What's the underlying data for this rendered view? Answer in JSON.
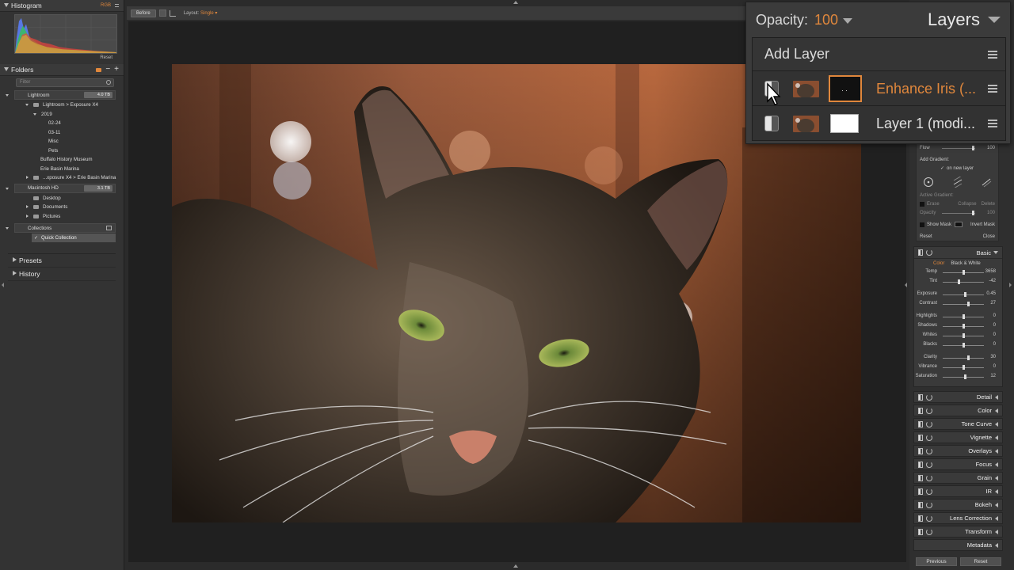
{
  "left_panel": {
    "histogram": {
      "title": "Histogram",
      "channel": "RGB",
      "reset": "Reset"
    },
    "folders": {
      "title": "Folders",
      "filter_placeholder": "Filter",
      "tree": [
        {
          "label": "Lightroom",
          "size": "4.0 TB",
          "kind": "drive"
        },
        {
          "label": "Lightroom > Exposure X4",
          "kind": "folder"
        },
        {
          "label": "2019",
          "kind": "folder"
        },
        {
          "label": "02-24",
          "kind": "leaf"
        },
        {
          "label": "03-11",
          "kind": "leaf"
        },
        {
          "label": "Misc",
          "kind": "leaf"
        },
        {
          "label": "Pets",
          "kind": "leaf"
        },
        {
          "label": "Buffalo History Museum",
          "kind": "leaf"
        },
        {
          "label": "Erie Basin Marina",
          "kind": "leaf"
        },
        {
          "label": "...xposure X4 > Erie Basin Marina",
          "kind": "folder"
        },
        {
          "label": "Macintosh HD",
          "size": "3.1 TB",
          "kind": "drive"
        },
        {
          "label": "Desktop",
          "kind": "folder"
        },
        {
          "label": "Documents",
          "kind": "folder"
        },
        {
          "label": "Pictures",
          "kind": "folder"
        }
      ],
      "collections": "Collections",
      "quick_collection": "Quick Collection"
    },
    "presets": "Presets",
    "history": "History"
  },
  "toolbar": {
    "before_label": "Before",
    "layout_label": "Layout:",
    "layout_value": "Single"
  },
  "layers_panel": {
    "opacity_label": "Opacity:",
    "opacity_value": "100",
    "title": "Layers",
    "add_layer": "Add Layer",
    "layers": [
      {
        "name": "Enhance Iris (...",
        "active": true
      },
      {
        "name": "Layer 1 (modi...",
        "active": false
      }
    ]
  },
  "brush_panel": {
    "flow_label": "Flow",
    "flow_value": "100",
    "add_gradient": "Add Gradient:",
    "on_new_layer": "on new layer",
    "active_gradient": "Active Gradient:",
    "erase": "Erase",
    "collapse": "Collapse",
    "delete": "Delete",
    "opacity_label": "Opacity",
    "opacity_value": "100",
    "show_mask": "Show Mask",
    "invert_mask": "Invert Mask",
    "reset": "Reset",
    "close": "Close"
  },
  "basic_panel": {
    "title": "Basic",
    "color_tab": "Color",
    "bw_tab": "Black & White",
    "adjustments": [
      {
        "label": "Temp",
        "value": "3658",
        "level": 0.5
      },
      {
        "label": "Tint",
        "value": "-42",
        "level": 0.4
      },
      {
        "label": "Exposure",
        "value": "0.45",
        "level": 0.55
      },
      {
        "label": "Contrast",
        "value": "27",
        "level": 0.62
      },
      {
        "label": "Highlights",
        "value": "0",
        "level": 0.5
      },
      {
        "label": "Shadows",
        "value": "0",
        "level": 0.5
      },
      {
        "label": "Whites",
        "value": "0",
        "level": 0.5
      },
      {
        "label": "Blacks",
        "value": "0",
        "level": 0.5
      },
      {
        "label": "Clarity",
        "value": "30",
        "level": 0.62
      },
      {
        "label": "Vibrance",
        "value": "0",
        "level": 0.5
      },
      {
        "label": "Saturation",
        "value": "12",
        "level": 0.54
      }
    ]
  },
  "panels": [
    "Detail",
    "Color",
    "Tone Curve",
    "Vignette",
    "Overlays",
    "Focus",
    "Grain",
    "IR",
    "Bokeh",
    "Lens Correction",
    "Transform",
    "Metadata"
  ],
  "footer": {
    "previous": "Previous",
    "reset": "Reset"
  },
  "colors": {
    "accent": "#e0873c",
    "panel": "#333333",
    "canvas": "#202020"
  }
}
